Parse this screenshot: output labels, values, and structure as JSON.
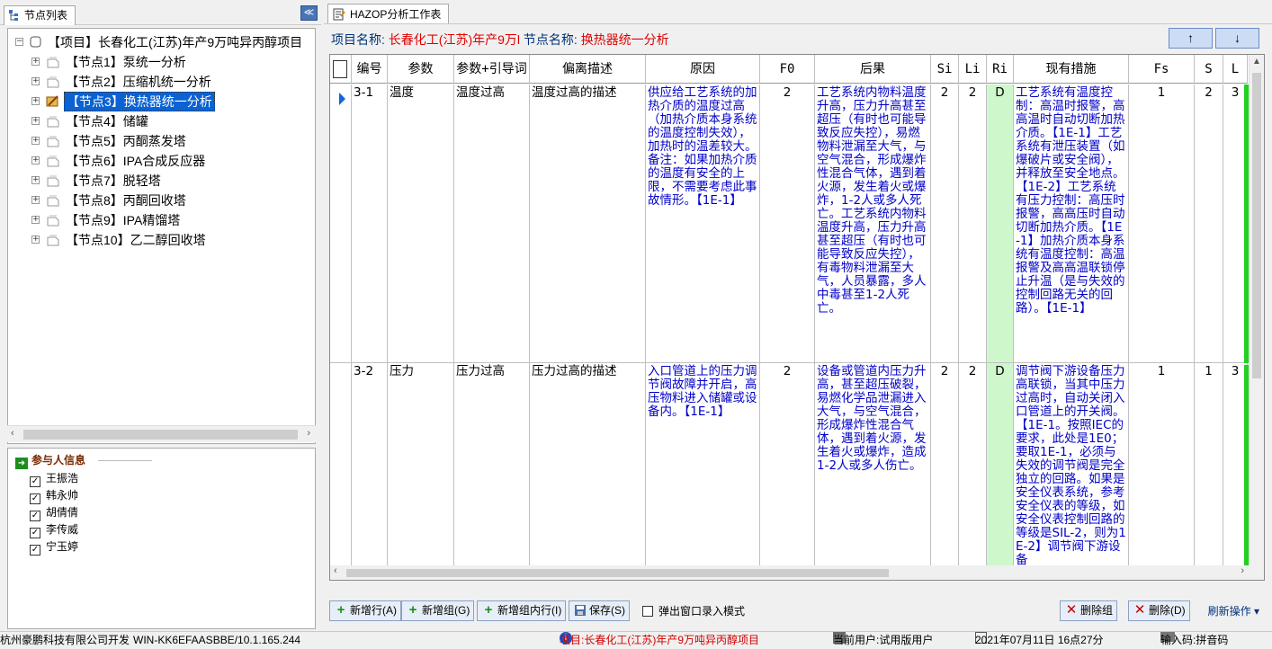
{
  "left_panel": {
    "tab_label": "节点列表",
    "collapse_icon": "double-chevron-left",
    "tree": {
      "root_label": "【项目】长春化工(江苏)年产9万吨异丙醇项目",
      "nodes": [
        {
          "label": "【节点1】泵统一分析"
        },
        {
          "label": "【节点2】压缩机统一分析"
        },
        {
          "label": "【节点3】换热器统一分析",
          "selected": true
        },
        {
          "label": "【节点4】储罐"
        },
        {
          "label": "【节点5】丙酮蒸发塔"
        },
        {
          "label": "【节点6】IPA合成反应器"
        },
        {
          "label": "【节点7】脱轻塔"
        },
        {
          "label": "【节点8】丙酮回收塔"
        },
        {
          "label": "【节点9】IPA精馏塔"
        },
        {
          "label": "【节点10】乙二醇回收塔"
        }
      ]
    },
    "participants": {
      "header": "参与人信息",
      "people": [
        "王振浩",
        "韩永帅",
        "胡倩倩",
        "李传威",
        "宁玉婷"
      ]
    }
  },
  "right_panel": {
    "tab_label": "HAZOP分析工作表",
    "project_label": "项目名称:",
    "project_value": "长春化工(江苏)年产9万l",
    "node_label": "节点名称:",
    "node_value": "换热器统一分析",
    "nav_up": "↑",
    "nav_down": "↓",
    "columns": [
      "编号",
      "参数",
      "参数+引导词",
      "偏离描述",
      "原因",
      "F0",
      "后果",
      "Si",
      "Li",
      "Ri",
      "现有措施",
      "Fs",
      "S",
      "L"
    ],
    "rows": [
      {
        "id": "3-1",
        "param": "温度",
        "param_guide": "温度过高",
        "deviation": "温度过高的描述",
        "cause": "供应给工艺系统的加热介质的温度过高（加热介质本身系统的温度控制失效），加热时的温差较大。备注：如果加热介质的温度有安全的上限，不需要考虑此事故情形。【1E-1】",
        "f0": "2",
        "consequence": "工艺系统内物料温度升高，压力升高甚至超压（有时也可能导致反应失控），易燃物料泄漏至大气，与空气混合，形成爆炸性混合气体，遇到着火源，发生着火或爆炸，1-2人或多人死亡。工艺系统内物料温度升高，压力升高甚至超压（有时也可能导致反应失控），有毒物料泄漏至大气，人员暴露，多人中毒甚至1-2人死亡。",
        "si": "2",
        "li": "2",
        "ri": "D",
        "measures": "工艺系统有温度控制：高温时报警，高高温时自动切断加热介质。【1E-1】工艺系统有泄压装置（如爆破片或安全阀），并释放至安全地点。【1E-2】工艺系统有压力控制：高压时报警，高高压时自动切断加热介质。【1E-1】加热介质本身系统有温度控制：高温报警及高高温联锁停止升温（是与失效的控制回路无关的回路）。【1E-1】",
        "fs": "1",
        "s": "2",
        "l": "3"
      },
      {
        "id": "3-2",
        "param": "压力",
        "param_guide": "压力过高",
        "deviation": "压力过高的描述",
        "cause": "入口管道上的压力调节阀故障并开启，高压物料进入储罐或设备内。【1E-1】",
        "f0": "2",
        "consequence": "设备或管道内压力升高，甚至超压破裂，易燃化学品泄漏进入大气，与空气混合，形成爆炸性混合气体，遇到着火源，发生着火或爆炸，造成1-2人或多人伤亡。",
        "si": "2",
        "li": "2",
        "ri": "D",
        "measures": "调节阀下游设备压力高联锁，当其中压力过高时，自动关闭入口管道上的开关阀。【1E-1。按照IEC的要求，此处是1E0；要取1E-1，必须与失效的调节阀是完全独立的回路。如果是安全仪表系统，参考安全仪表的等级，如安全仪表控制回路的等级是SIL-2，则为1E-2】调节阀下游设备",
        "fs": "1",
        "s": "1",
        "l": "3"
      }
    ],
    "toolbar": {
      "add_row": "新增行(A)",
      "add_group": "新增组(G)",
      "add_group_row": "新增组内行(I)",
      "save": "保存(S)",
      "popup_mode": "弹出窗口录入模式",
      "delete_group": "删除组",
      "delete": "删除(D)",
      "refresh": "刷新操作"
    }
  },
  "status_bar": {
    "developer": "杭州豪鹏科技有限公司开发",
    "machine": "WIN-KK6EFAASBBE/10.1.165.244",
    "project": "项目:长春化工(江苏)年产9万吨异丙醇项目",
    "user": "当前用户:试用版用户",
    "datetime": "2021年07月11日 16点27分",
    "ime": "输入码:拼音码"
  },
  "colors": {
    "selection": "#0a62d3",
    "ri_fill": "#cff7cc",
    "text_blue": "#0000c8",
    "accent_red": "#e00000",
    "risk_bar": "#22d022"
  }
}
